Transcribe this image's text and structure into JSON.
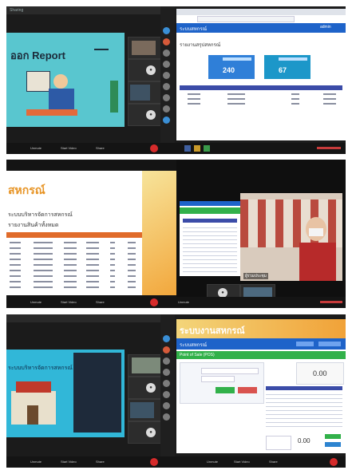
{
  "panel1": {
    "window_title": "Sharing",
    "slide_title": "ออก Report",
    "toolbar": [
      "Unmute",
      "Start Video",
      "Share",
      "End"
    ]
  },
  "panel2": {
    "app_title": "ระบบสหกรณ์",
    "user_name": "admin",
    "subtitle": "รายงานสรุปสหกรณ์",
    "card1_value": "240",
    "card2_value": "67",
    "accent": "#1e63c9"
  },
  "panel3": {
    "slide_title": "สหกรณ์",
    "heading1": "ระบบบริหารจัดการสหกรณ์",
    "heading2": "รายงานสินค้าทั้งหมด",
    "toolbar": [
      "Unmute",
      "Start Video",
      "Share",
      "End"
    ]
  },
  "panel4": {
    "caption": "ผู้ร่วมประชุม",
    "toolbar": [
      "Unmute",
      "Start Video",
      "Share",
      "End"
    ]
  },
  "panel5": {
    "slide_title": "ระบบบริหารจัดการสหกรณ์",
    "toolbar": [
      "Unmute",
      "Start Video",
      "Share",
      "End"
    ]
  },
  "panel6": {
    "banner": "ระบบงานสหกรณ์",
    "app_title": "ระบบสหกรณ์",
    "form_title": "Point of Sale (POS)",
    "total_value": "0.00",
    "change_value": "0.00",
    "toolbar": [
      "Unmute",
      "Start Video",
      "Share",
      "End"
    ]
  }
}
